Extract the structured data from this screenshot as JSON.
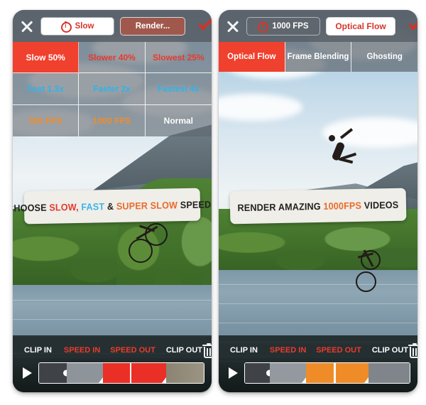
{
  "colors": {
    "accent_red": "#f0402e",
    "accent_orange": "#f08d2a",
    "accent_blue": "#2fb3e8",
    "chrome_gray": "#5b6168",
    "render_btn": "#a1584c",
    "banner_bg": "#efeee9"
  },
  "left_panel": {
    "topbar": {
      "close_label": "close-icon",
      "timer_icon": "stopwatch-icon",
      "speed_label": "Slow",
      "render_label": "Render...",
      "confirm_label": "check-icon"
    },
    "speed_grid": [
      {
        "label": "Slow 50%",
        "style": "sel"
      },
      {
        "label": "Slower 40%",
        "style": "slow"
      },
      {
        "label": "Slowest 25%",
        "style": "slow"
      },
      {
        "label": "Fast 1.3x",
        "style": "fast"
      },
      {
        "label": "Faster 2x",
        "style": "fast"
      },
      {
        "label": "Fastest 4x",
        "style": "fast"
      },
      {
        "label": "500 FPS",
        "style": "fps"
      },
      {
        "label": "1000 FPS",
        "style": "fps"
      },
      {
        "label": "Normal",
        "style": "normal"
      }
    ],
    "banner": {
      "part1": "CHOOSE ",
      "part2": "SLOW,",
      "part3": " ",
      "part4": "FAST",
      "part5": " & ",
      "part6": "SUPER SLOW",
      "part7": " SPEEDS"
    },
    "bottom": {
      "clip_in": "CLIP IN",
      "speed_in": "SPEED IN",
      "speed_out": "SPEED OUT",
      "clip_out": "CLIP OUT",
      "delete_label": "trash-icon",
      "play_label": "play-icon"
    },
    "timeline": {
      "segments": [
        {
          "color": "#3f4348",
          "width": "17%"
        },
        {
          "color": "#8d949a",
          "width": "22%"
        },
        {
          "color": "#ea2f26",
          "width": "16%"
        },
        {
          "color": "#ea2f26",
          "width": "22%"
        },
        {
          "color": "#8b8472",
          "width": "23%"
        }
      ],
      "playhead_pos": "55%"
    }
  },
  "right_panel": {
    "topbar": {
      "close_label": "close-icon",
      "timer_icon": "stopwatch-icon",
      "speed_label": "1000 FPS",
      "mode_label": "Optical Flow",
      "confirm_label": "check-icon"
    },
    "tabs": [
      {
        "label": "Optical Flow",
        "active": true
      },
      {
        "label": "Frame Blending",
        "active": false
      },
      {
        "label": "Ghosting",
        "active": false
      }
    ],
    "banner": {
      "part1": "RENDER AMAZING ",
      "part2": "1000FPS",
      "part3": " VIDEOS"
    },
    "bottom": {
      "clip_in": "CLIP IN",
      "speed_in": "SPEED IN",
      "speed_out": "SPEED OUT",
      "clip_out": "CLIP OUT",
      "delete_label": "trash-icon",
      "play_label": "play-icon"
    },
    "timeline": {
      "segments": [
        {
          "color": "#3f4348",
          "width": "15%"
        },
        {
          "color": "#93999e",
          "width": "22%"
        },
        {
          "color": "#ef8c28",
          "width": "17%"
        },
        {
          "color": "#ef8c28",
          "width": "21%"
        },
        {
          "color": "#7f858a",
          "width": "25%"
        }
      ],
      "playhead_pos": "54%"
    }
  }
}
